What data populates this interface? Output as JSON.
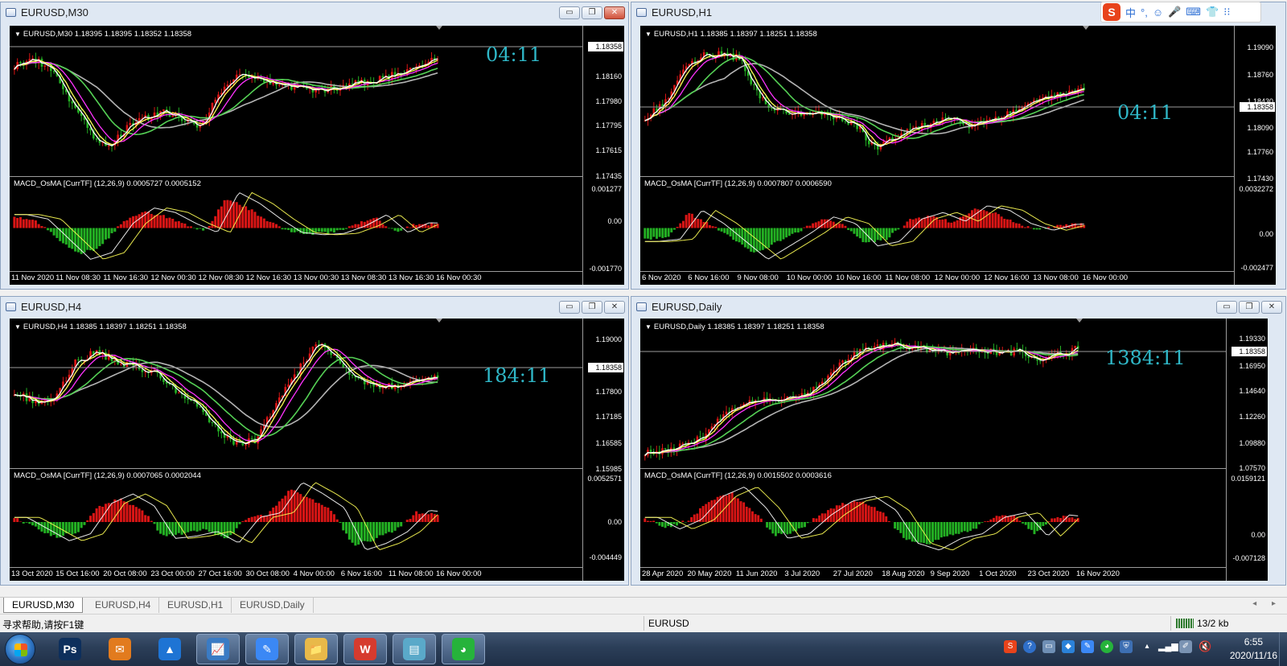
{
  "windows": [
    {
      "id": "m30",
      "title": "EURUSD,M30",
      "ohlc": "EURUSD,M30  1.18395 1.18395 1.18352 1.18358",
      "macd": "MACD_OsMA [CurrTF] (12,26,9) 0.0005727 0.0005152",
      "timer": "04:11",
      "price_label": "1.18358",
      "price_ticks": [
        "1.18160",
        "1.17980",
        "1.17795",
        "1.17615",
        "1.17435"
      ],
      "macd_ticks": [
        "0.001277",
        "0.00",
        "-0.001770"
      ],
      "time_labels": [
        "11 Nov 2020",
        "11 Nov 08:30",
        "11 Nov 16:30",
        "12 Nov 00:30",
        "12 Nov 08:30",
        "12 Nov 16:30",
        "13 Nov 00:30",
        "13 Nov 08:30",
        "13 Nov 16:30",
        "16 Nov 00:30"
      ]
    },
    {
      "id": "h1",
      "title": "EURUSD,H1",
      "ohlc": "EURUSD,H1  1.18385 1.18397 1.18251 1.18358",
      "macd": "MACD_OsMA [CurrTF] (12,26,9) 0.0007807 0.0006590",
      "timer": "04:11",
      "price_label": "1.18358",
      "price_ticks": [
        "1.19090",
        "1.18760",
        "1.18430",
        "1.18090",
        "1.17760",
        "1.17430"
      ],
      "macd_ticks": [
        "0.0032272",
        "0.00",
        "-0.002477"
      ],
      "time_labels": [
        "6 Nov 2020",
        "6 Nov 16:00",
        "9 Nov 08:00",
        "10 Nov 00:00",
        "10 Nov 16:00",
        "11 Nov 08:00",
        "12 Nov 00:00",
        "12 Nov 16:00",
        "13 Nov 08:00",
        "16 Nov 00:00"
      ]
    },
    {
      "id": "h4",
      "title": "EURUSD,H4",
      "ohlc": "EURUSD,H4  1.18385 1.18397 1.18251 1.18358",
      "macd": "MACD_OsMA [CurrTF] (12,26,9) 0.0007065 0.0002044",
      "timer": "184:11",
      "price_label": "1.18358",
      "price_ticks": [
        "1.19000",
        "1.17800",
        "1.17185",
        "1.16585",
        "1.15985"
      ],
      "macd_ticks": [
        "0.0052571",
        "0.00",
        "-0.004449"
      ],
      "time_labels": [
        "13 Oct 2020",
        "15 Oct 16:00",
        "20 Oct 08:00",
        "23 Oct 00:00",
        "27 Oct 16:00",
        "30 Oct 08:00",
        "4 Nov 00:00",
        "6 Nov 16:00",
        "11 Nov 08:00",
        "16 Nov 00:00"
      ]
    },
    {
      "id": "d1",
      "title": "EURUSD,Daily",
      "ohlc": "EURUSD,Daily  1.18385 1.18397 1.18251 1.18358",
      "macd": "MACD_OsMA [CurrTF] (12,26,9) 0.0015502 0.0003616",
      "timer": "1384:11",
      "price_label": "1.18358",
      "price_ticks": [
        "1.19330",
        "1.16950",
        "1.14640",
        "1.12260",
        "1.09880",
        "1.07570"
      ],
      "macd_ticks": [
        "0.0159121",
        "0.00",
        "-0.007128"
      ],
      "time_labels": [
        "28 Apr 2020",
        "20 May 2020",
        "11 Jun 2020",
        "3 Jul 2020",
        "27 Jul 2020",
        "18 Aug 2020",
        "9 Sep 2020",
        "1 Oct 2020",
        "23 Oct 2020",
        "16 Nov 2020"
      ]
    }
  ],
  "window_controls": {
    "minimize": "▭",
    "maximize": "❐",
    "close": "✕"
  },
  "tabs": [
    {
      "label": "EURUSD,M30",
      "active": true
    },
    {
      "label": "EURUSD,H4",
      "active": false
    },
    {
      "label": "EURUSD,H1",
      "active": false
    },
    {
      "label": "EURUSD,Daily",
      "active": false
    }
  ],
  "tab_nav": "◂ ▸",
  "status": {
    "help": "寻求帮助,请按F1键",
    "symbol": "EURUSD",
    "traffic": "13/2 kb"
  },
  "ime": {
    "logo": "S",
    "mode": "中",
    "punct": "°,",
    "emoji": "☺",
    "voice": "🎤",
    "keyboard": "⌨",
    "skin": "👕",
    "tools": "⁝⁝"
  },
  "taskbar": {
    "apps": [
      {
        "name": "photoshop",
        "glyph": "Ps",
        "color": "#0d2f5c",
        "open": false
      },
      {
        "name": "foxmail",
        "glyph": "✉",
        "color": "#e27b1e",
        "open": false
      },
      {
        "name": "lanhu",
        "glyph": "▲",
        "color": "#1e74d4",
        "open": false
      },
      {
        "name": "metatrader",
        "glyph": "📈",
        "color": "#3a7bc4",
        "open": true
      },
      {
        "name": "feishu",
        "glyph": "✎",
        "color": "#3b88f5",
        "open": true
      },
      {
        "name": "explorer",
        "glyph": "📁",
        "color": "#e9b949",
        "open": true
      },
      {
        "name": "wps",
        "glyph": "W",
        "color": "#d63b2e",
        "open": true
      },
      {
        "name": "notes",
        "glyph": "▤",
        "color": "#5aa9c9",
        "open": true
      },
      {
        "name": "wechat",
        "glyph": "◕",
        "color": "#26b33b",
        "open": true
      }
    ],
    "time": "6:55",
    "date": "2020/11/16"
  },
  "colors": {
    "bull": "#d91515",
    "bear": "#23b023",
    "ma_white": "#ffffff",
    "ma_yellow": "#ffff55",
    "ma_magenta": "#ff33ff",
    "ma_green": "#55d155",
    "ma_gray": "#b4b4b4",
    "timer": "#2fb7c7"
  }
}
